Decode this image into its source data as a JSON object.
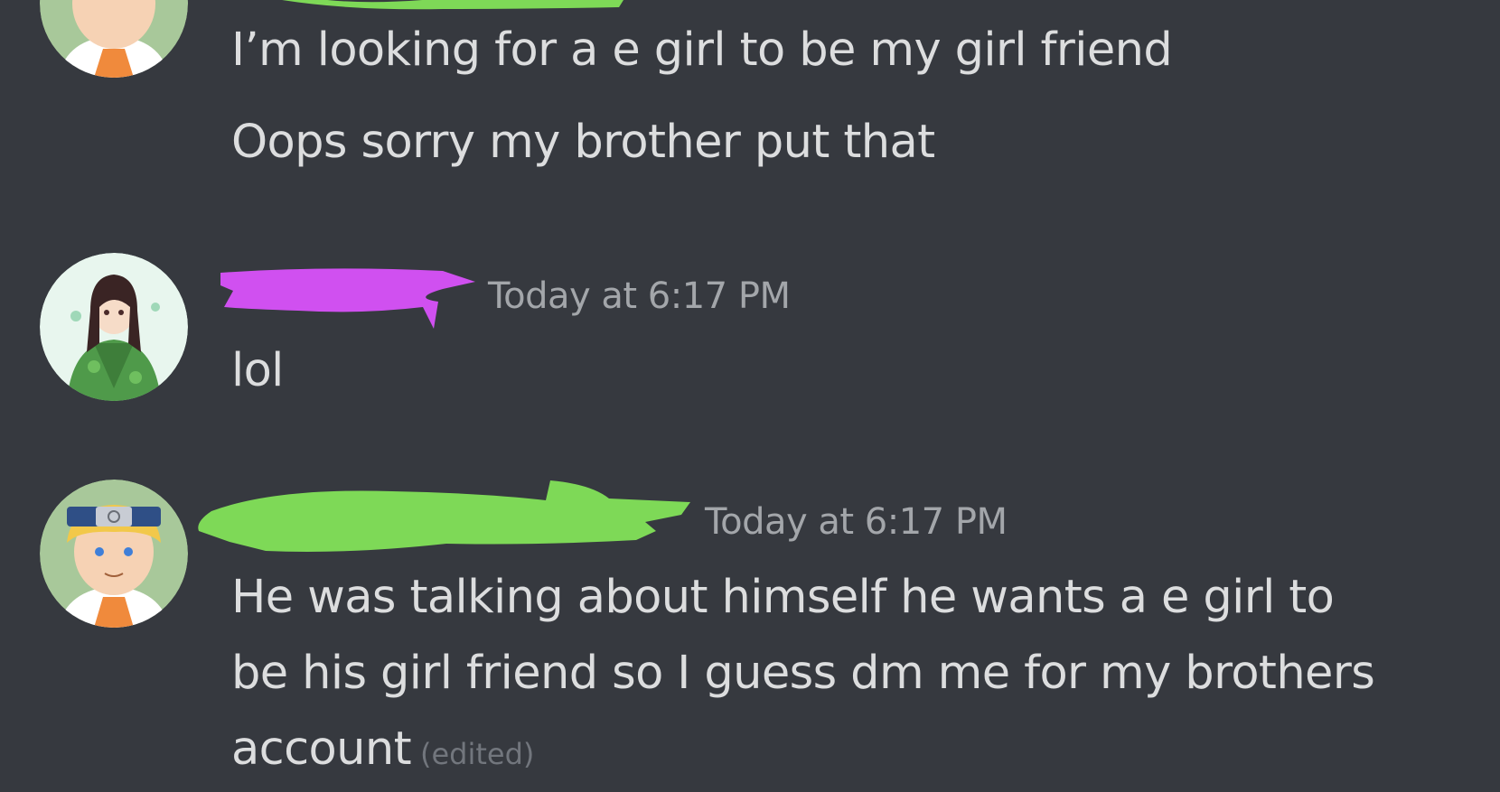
{
  "messages": [
    {
      "author_redaction_color": "#7ed957",
      "lines": [
        "I’m looking for a e girl to be my girl friend",
        "Oops sorry my brother put that"
      ]
    },
    {
      "author_redaction_color": "#d050f0",
      "timestamp": "Today at 6:17 PM",
      "lines": [
        "lol"
      ]
    },
    {
      "author_redaction_color": "#7ed957",
      "timestamp": "Today at 6:17 PM",
      "lines": [
        "He was talking about himself he wants a e girl to",
        "be his girl friend so I guess dm me for my brothers",
        "account"
      ],
      "edited_label": "(edited)"
    }
  ],
  "avatars": {
    "ninja_boy": "naruto-avatar-icon",
    "green_hoodie_girl": "anime-girl-avatar-icon"
  }
}
